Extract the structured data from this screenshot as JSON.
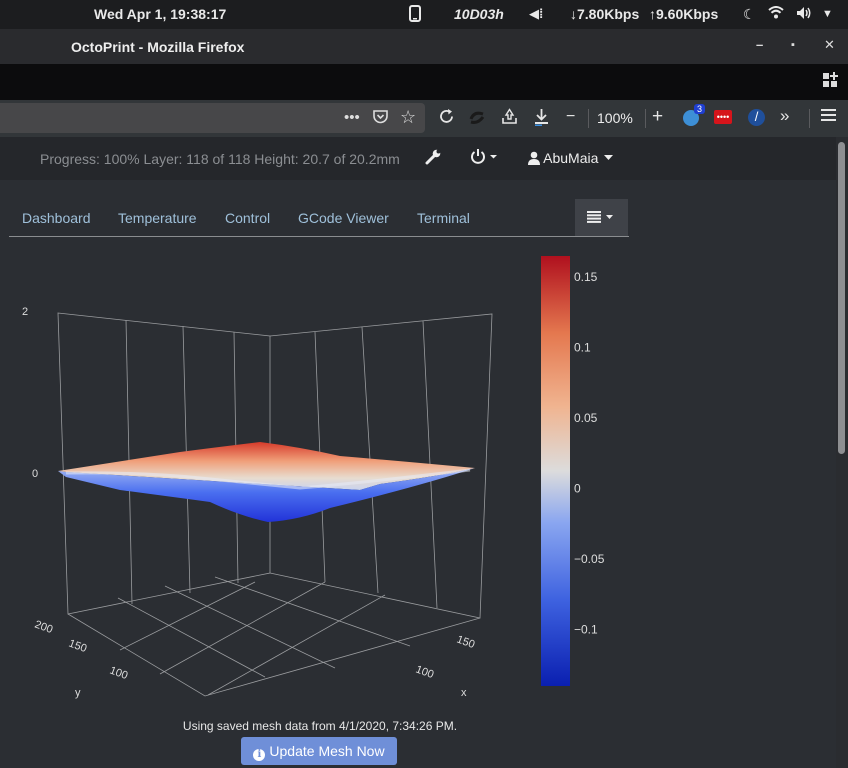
{
  "system": {
    "clock": "Wed Apr  1, 19:38:17",
    "device": "10D03h",
    "download": "↓7.80Kbps",
    "upload": "↑9.60Kbps",
    "icons": [
      "phone-icon",
      "network-icon",
      "moon-icon",
      "wifi-icon",
      "volume-icon",
      "menu-caret-icon"
    ]
  },
  "window": {
    "title": "OctoPrint - Mozilla Firefox",
    "minimize": "–",
    "maximize": "▪",
    "close": "✕"
  },
  "navbar": {
    "zoom": "100%",
    "badge_count": "3",
    "zoom_out": "−",
    "zoom_in": "+"
  },
  "octoprint": {
    "progress_text": "Progress: 100% Layer: 118 of 118 Height: 20.7 of 20.2mm",
    "user": "AbuMaia"
  },
  "tabs": [
    {
      "label": "Dashboard"
    },
    {
      "label": "Temperature"
    },
    {
      "label": "Control"
    },
    {
      "label": "GCode Viewer"
    },
    {
      "label": "Terminal"
    }
  ],
  "chart_data": {
    "type": "surface",
    "title": "",
    "z_tick_labels": [
      "2",
      "0"
    ],
    "y_axis_label": "y",
    "y_tick_labels": [
      "200",
      "150",
      "100"
    ],
    "x_axis_label": "x",
    "x_tick_labels": [
      "150",
      "100"
    ],
    "colorscale": {
      "min": -0.14,
      "max": 0.165,
      "ticks": [
        0.15,
        0.1,
        0.05,
        0,
        -0.05,
        -0.1
      ],
      "tick_labels": [
        "0.15",
        "0.1",
        "0.05",
        "0",
        "−0.05",
        "−0.1"
      ],
      "colors": [
        "#0a1fb0",
        "#3e62e0",
        "#8aa6f0",
        "#dcdcdc",
        "#f0b490",
        "#e4784f",
        "#b0101e"
      ]
    },
    "grid": true,
    "legend": "right"
  },
  "mesh": {
    "note": "Using saved mesh data from 4/1/2020, 7:34:26 PM.",
    "button_label": "Update Mesh Now"
  }
}
